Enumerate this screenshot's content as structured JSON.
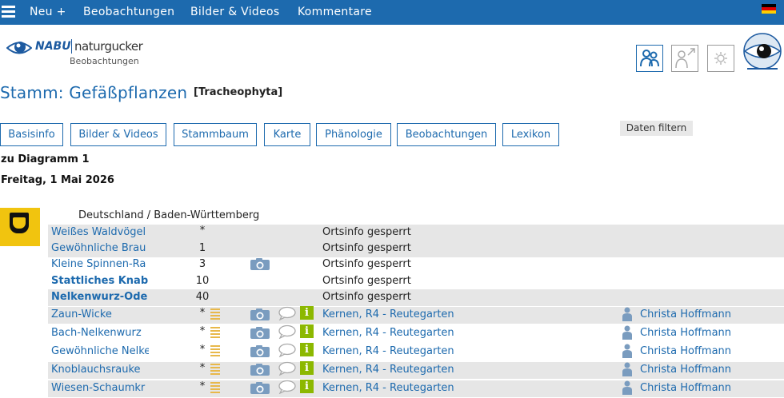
{
  "topnav": {
    "items": [
      "Neu +",
      "Beobachtungen",
      "Bilder & Videos",
      "Kommentare"
    ]
  },
  "logo": {
    "brand": "NABU",
    "name": "naturgucker",
    "sub": "Beobachtungen"
  },
  "title": {
    "main": "Stamm: Gefäßpflanzen",
    "latin": "[Tracheophyta]"
  },
  "tabs": [
    "Basisinfo",
    "Bilder & Videos",
    "Stammbaum",
    "Karte",
    "Phänologie",
    "Beobachtungen",
    "Lexikon"
  ],
  "filter_label": "Daten filtern",
  "diagram_link": "zu Diagramm 1",
  "date": "Freitag, 1 Mai 2026",
  "region": "Deutschland / Baden-Württemberg",
  "rows": [
    {
      "name": "Weißes Waldvögel",
      "count": "*",
      "list": false,
      "cam": false,
      "chat": false,
      "info": false,
      "loc": "Ortsinfo gesperrt",
      "observer": "",
      "bold": false,
      "shaded": true
    },
    {
      "name": "Gewöhnliche Brau",
      "count": "1",
      "list": false,
      "cam": false,
      "chat": false,
      "info": false,
      "loc": "Ortsinfo gesperrt",
      "observer": "",
      "bold": false,
      "shaded": true
    },
    {
      "name": "Kleine Spinnen-Ra",
      "count": "3",
      "list": false,
      "cam": true,
      "chat": false,
      "info": false,
      "loc": "Ortsinfo gesperrt",
      "observer": "",
      "bold": false,
      "shaded": false
    },
    {
      "name": "Stattliches Knab",
      "count": "10",
      "list": false,
      "cam": false,
      "chat": false,
      "info": false,
      "loc": "Ortsinfo gesperrt",
      "observer": "",
      "bold": true,
      "shaded": false
    },
    {
      "name": "Nelkenwurz-Ode",
      "count": "40",
      "list": false,
      "cam": false,
      "chat": false,
      "info": false,
      "loc": "Ortsinfo gesperrt",
      "observer": "",
      "bold": true,
      "shaded": true
    },
    {
      "name": "Zaun-Wicke",
      "count": "*",
      "list": true,
      "cam": true,
      "chat": true,
      "info": true,
      "loc": "Kernen, R4 - Reutegarten",
      "observer": "Christa Hoffmann",
      "bold": false,
      "shaded": true
    },
    {
      "name": "Bach-Nelkenwurz",
      "count": "*",
      "list": true,
      "cam": true,
      "chat": true,
      "info": true,
      "loc": "Kernen, R4 - Reutegarten",
      "observer": "Christa Hoffmann",
      "bold": false,
      "shaded": false
    },
    {
      "name": "Gewöhnliche Nelke",
      "count": "*",
      "list": true,
      "cam": true,
      "chat": true,
      "info": true,
      "loc": "Kernen, R4 - Reutegarten",
      "observer": "Christa Hoffmann",
      "bold": false,
      "shaded": false
    },
    {
      "name": "Knoblauchsrauke",
      "count": "*",
      "list": true,
      "cam": true,
      "chat": true,
      "info": true,
      "loc": "Kernen, R4 - Reutegarten",
      "observer": "Christa Hoffmann",
      "bold": false,
      "shaded": true
    },
    {
      "name": "Wiesen-Schaumkr",
      "count": "*",
      "list": true,
      "cam": true,
      "chat": true,
      "info": true,
      "loc": "Kernen, R4 - Reutegarten",
      "observer": "Christa Hoffmann",
      "bold": false,
      "shaded": true
    }
  ],
  "colors": {
    "brand": "#1d6aae",
    "info": "#8cb800",
    "list": "#e8b84a",
    "shade": "#e6e6e6"
  },
  "icons": [
    "hamburger-icon",
    "flag-germany-icon",
    "community-icon",
    "person-arrow-icon",
    "settings-icon",
    "camera-icon",
    "comment-icon",
    "info-icon",
    "list-icon",
    "person-icon",
    "coat-of-arms-icon"
  ]
}
